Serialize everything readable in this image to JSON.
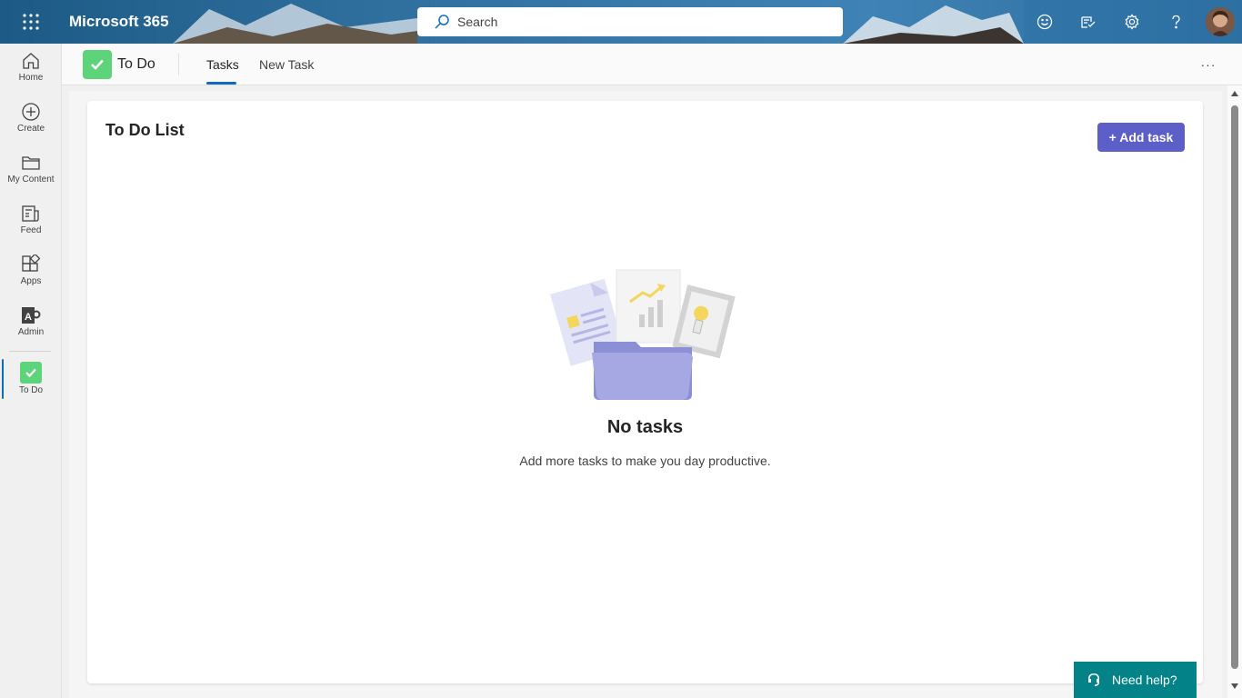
{
  "suite": {
    "brand": "Microsoft 365",
    "search_placeholder": "Search",
    "icons": [
      "waffle-icon",
      "feedback-icon",
      "whats-new-icon",
      "settings-icon",
      "help-icon"
    ]
  },
  "rail": {
    "items": [
      {
        "label": "Home",
        "icon": "home-icon"
      },
      {
        "label": "Create",
        "icon": "create-icon"
      },
      {
        "label": "My Content",
        "icon": "folder-icon"
      },
      {
        "label": "Feed",
        "icon": "feed-icon"
      },
      {
        "label": "Apps",
        "icon": "apps-icon"
      },
      {
        "label": "Admin",
        "icon": "admin-icon"
      },
      {
        "label": "To Do",
        "icon": "todo-icon",
        "active": true
      }
    ]
  },
  "app": {
    "name": "To Do",
    "tabs": [
      {
        "label": "Tasks",
        "active": true
      },
      {
        "label": "New Task",
        "active": false
      }
    ],
    "more_label": "···"
  },
  "main": {
    "title": "To Do List",
    "add_button": "+ Add task",
    "empty_title": "No tasks",
    "empty_subtitle": "Add more tasks to make you day productive."
  },
  "help": {
    "label": "Need help?"
  },
  "colors": {
    "accent": "#5b5fc7",
    "todo_green": "#5ed47a",
    "help_teal": "#038387",
    "active_tab": "#0f6cbd"
  }
}
